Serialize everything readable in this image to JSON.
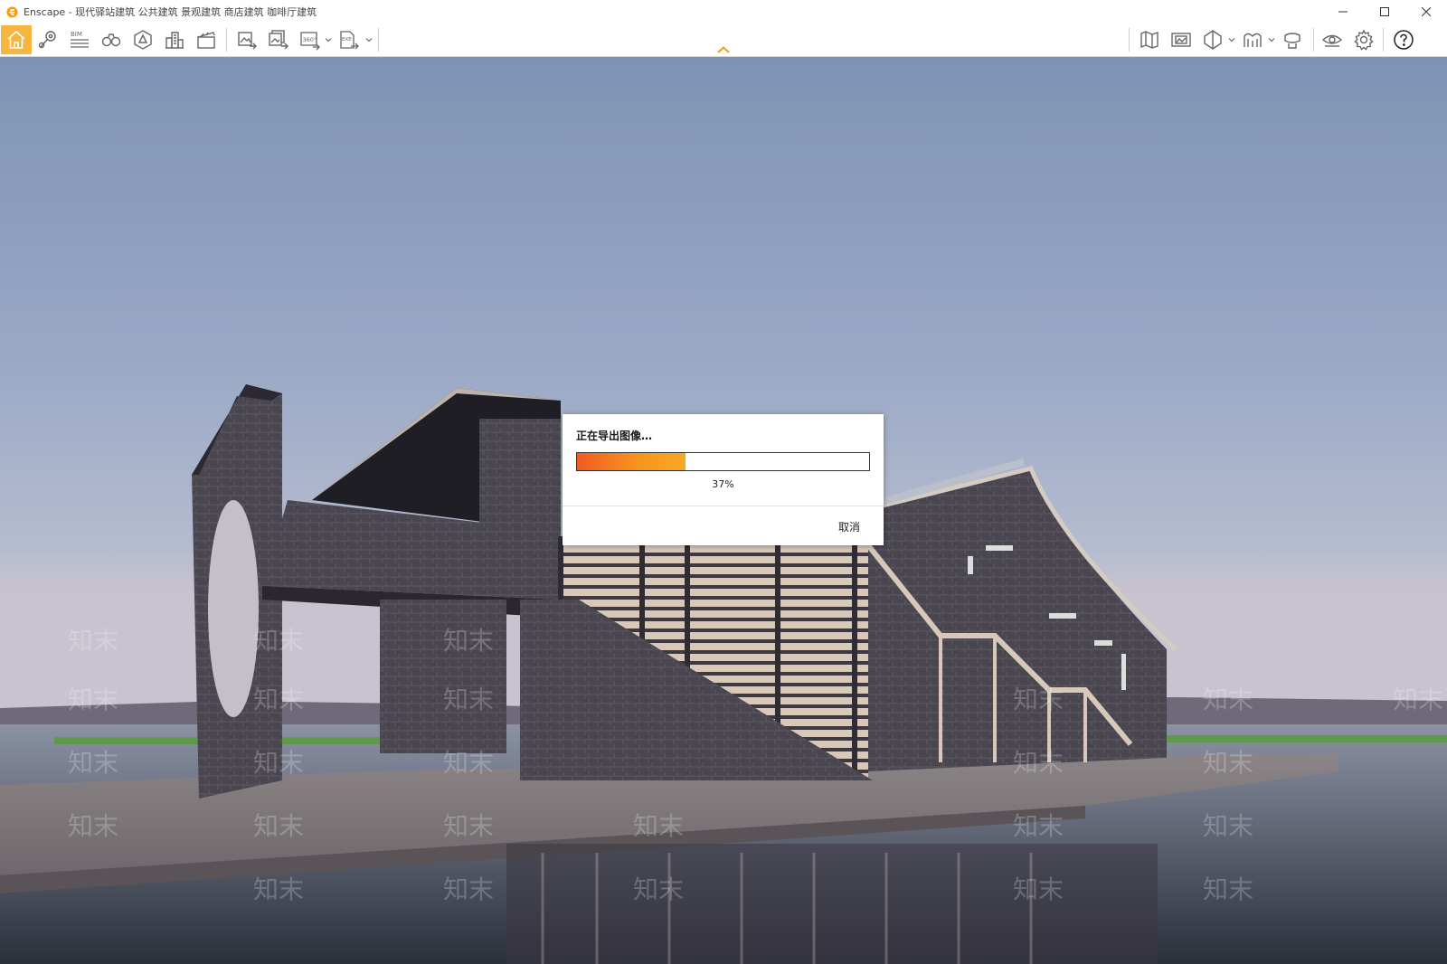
{
  "window": {
    "title": "Enscape - 现代驿站建筑 公共建筑 景观建筑 商店建筑 咖啡厅建筑",
    "controls": [
      "minimize-icon",
      "maximize-icon",
      "close-icon"
    ]
  },
  "toolbar": {
    "left_tools": [
      {
        "icon": "home-icon",
        "active": true
      },
      {
        "icon": "location-pin-icon"
      },
      {
        "icon": "bim-icon",
        "label": "BIM"
      },
      {
        "icon": "binoculars-icon"
      },
      {
        "icon": "asset-library-icon"
      },
      {
        "icon": "buildings-icon"
      },
      {
        "icon": "clapperboard-icon"
      },
      {
        "icon": "export-image-icon"
      },
      {
        "icon": "batch-export-icon"
      },
      {
        "icon": "panorama-360-icon",
        "label": "360°"
      },
      {
        "icon": "export-exe-icon",
        "label": "EXE"
      }
    ],
    "right_tools": [
      {
        "icon": "map-icon"
      },
      {
        "icon": "screenshot-manager-icon"
      },
      {
        "icon": "view-cube-icon"
      },
      {
        "icon": "vr-headset-icon"
      },
      {
        "icon": "display-icon"
      },
      {
        "icon": "eye-icon"
      },
      {
        "icon": "settings-gear-icon"
      },
      {
        "icon": "help-icon"
      }
    ],
    "accent_color": "#f6b53e"
  },
  "dialog": {
    "title": "正在导出图像…",
    "progress": 37,
    "progress_text": "37%",
    "cancel_label": "取消",
    "progress_colors": [
      "#f15a24",
      "#f9a825"
    ]
  },
  "watermark": {
    "text": "知末"
  }
}
